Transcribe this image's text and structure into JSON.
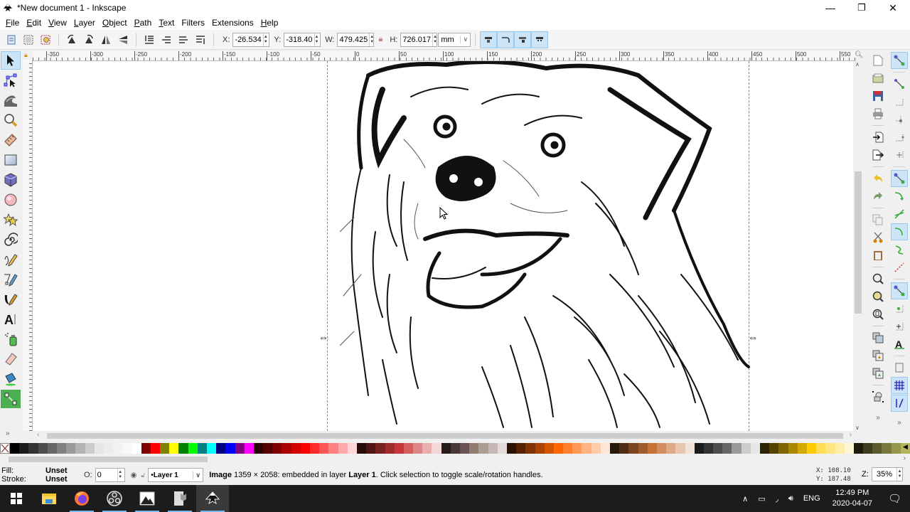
{
  "window": {
    "title": "*New document 1 - Inkscape",
    "minimize_label": "—",
    "restore_label": "❐",
    "close_label": "✕"
  },
  "menu": [
    {
      "label": "File",
      "mnemonic": "F",
      "rest": "ile"
    },
    {
      "label": "Edit",
      "mnemonic": "E",
      "rest": "dit"
    },
    {
      "label": "View",
      "mnemonic": "V",
      "rest": "iew"
    },
    {
      "label": "Layer",
      "mnemonic": "L",
      "rest": "ayer"
    },
    {
      "label": "Object",
      "mnemonic": "O",
      "rest": "bject"
    },
    {
      "label": "Path",
      "mnemonic": "P",
      "rest": "ath"
    },
    {
      "label": "Text",
      "mnemonic": "T",
      "rest": "ext"
    },
    {
      "label": "Filters",
      "mnemonic": "",
      "rest": "Filters"
    },
    {
      "label": "Extensions",
      "mnemonic": "",
      "rest": "Extensions"
    },
    {
      "label": "Help",
      "mnemonic": "H",
      "rest": "elp"
    }
  ],
  "toolbar": {
    "x_label": "X:",
    "x_value": "-26.534",
    "y_label": "Y:",
    "y_value": "-318.40",
    "w_label": "W:",
    "w_value": "479.425",
    "h_label": "H:",
    "h_value": "726.017",
    "unit": "mm",
    "lock_icon": "lock-icon"
  },
  "ruler": {
    "h_labels": [
      "-350",
      "-300",
      "-250",
      "-200",
      "-150",
      "-100",
      "-50",
      "0",
      "50",
      "100",
      "150",
      "200",
      "250",
      "300",
      "350",
      "400",
      "450",
      "500",
      "550"
    ]
  },
  "tools": [
    {
      "name": "selector-tool",
      "active": true
    },
    {
      "name": "node-tool"
    },
    {
      "name": "tweak-tool"
    },
    {
      "name": "zoom-tool"
    },
    {
      "name": "measure-tool"
    },
    {
      "name": "rectangle-tool"
    },
    {
      "name": "3d-box-tool"
    },
    {
      "name": "ellipse-tool"
    },
    {
      "name": "star-tool"
    },
    {
      "name": "spiral-tool"
    },
    {
      "name": "pencil-tool"
    },
    {
      "name": "pen-tool"
    },
    {
      "name": "calligraphy-tool"
    },
    {
      "name": "text-tool"
    },
    {
      "name": "spray-tool"
    },
    {
      "name": "eraser-tool"
    },
    {
      "name": "paint-bucket-tool"
    },
    {
      "name": "connector-tool"
    }
  ],
  "palette": {
    "colors": [
      "#000000",
      "#1a1a1a",
      "#333333",
      "#4d4d4d",
      "#666666",
      "#808080",
      "#999999",
      "#b3b3b3",
      "#cccccc",
      "#e6e6e6",
      "#ececec",
      "#f2f2f2",
      "#f8f8f8",
      "#ffffff",
      "#800000",
      "#ff0000",
      "#808000",
      "#ffff00",
      "#008000",
      "#00ff00",
      "#008080",
      "#00ffff",
      "#000080",
      "#0000ff",
      "#800080",
      "#ff00ff",
      "#2b0000",
      "#550000",
      "#800000",
      "#aa0000",
      "#d40000",
      "#ff0000",
      "#ff2a2a",
      "#ff5555",
      "#ff8080",
      "#ffaaaa",
      "#ffd5d5",
      "#280b0b",
      "#501616",
      "#782121",
      "#a02c2c",
      "#c83737",
      "#d35f5f",
      "#de8787",
      "#e9afaf",
      "#f4d7d7",
      "#241c1c",
      "#483737",
      "#6c5353",
      "#917c6f",
      "#ac9d93",
      "#c8b7b7",
      "#e3dbdb",
      "#2b1100",
      "#552200",
      "#803300",
      "#aa4400",
      "#d45500",
      "#ff6600",
      "#ff7f2a",
      "#ff9955",
      "#ffb380",
      "#ffccaa",
      "#ffe6d5",
      "#28170b",
      "#502d16",
      "#784421",
      "#a05a2c",
      "#c87137",
      "#d38d5f",
      "#deaa87",
      "#e9c6af",
      "#f4e3d7",
      "#1a1a1a",
      "#333333",
      "#4d4d4d",
      "#666666",
      "#999999",
      "#cccccc",
      "#e6e6e6",
      "#2b2200",
      "#554400",
      "#806600",
      "#aa8800",
      "#d4aa00",
      "#ffcc00",
      "#ffdd55",
      "#ffe680",
      "#ffeeaa",
      "#fff6d5",
      "#1c1c0e",
      "#3c3c1f",
      "#5a5a2e",
      "#78783d",
      "#96964d",
      "#b4b45c"
    ]
  },
  "status": {
    "fill_label": "Fill:",
    "fill_value": "Unset",
    "stroke_label": "Stroke:",
    "stroke_value": "Unset",
    "opacity_label": "O:",
    "opacity_value": "0",
    "layer": "•Layer 1",
    "message_bold": "Image",
    "message_1": " 1359 × 2058: embedded in layer ",
    "message_layer": "Layer 1",
    "message_2": ". Click selection to toggle scale/rotation handles.",
    "cursor_x": "X:  108.10",
    "cursor_y": "Y:  187.48",
    "zoom_label": "Z:",
    "zoom_value": "35%"
  },
  "taskbar": {
    "apps": [
      {
        "name": "start-button"
      },
      {
        "name": "file-explorer",
        "run": false
      },
      {
        "name": "firefox",
        "run": true
      },
      {
        "name": "obs-studio",
        "run": true
      },
      {
        "name": "photos",
        "run": true
      },
      {
        "name": "image-viewer",
        "run": true
      },
      {
        "name": "inkscape",
        "run": true,
        "active": true
      }
    ],
    "language": "ENG",
    "time": "12:49 PM",
    "date": "2020-04-07"
  }
}
